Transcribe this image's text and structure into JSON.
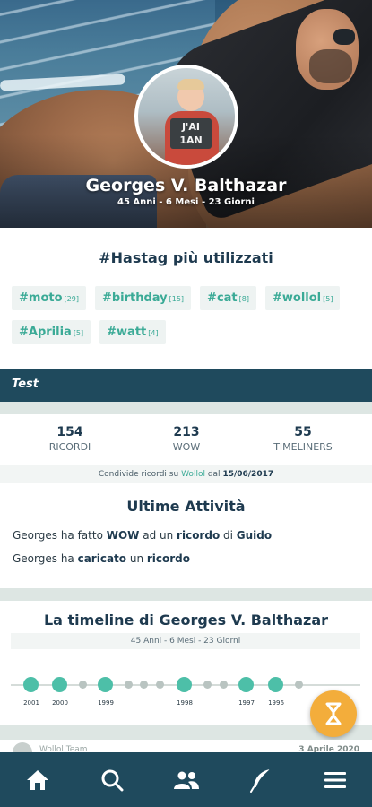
{
  "profile": {
    "name": "Georges V. Balthazar",
    "age": "45 Anni - 6 Mesi - 23 Giorni",
    "avatar_sign": "J'AI 1AN"
  },
  "hashtags": {
    "title": "#Hastag più utilizzati",
    "items": [
      {
        "tag": "#moto",
        "count": "[29]"
      },
      {
        "tag": "#birthday",
        "count": "[15]"
      },
      {
        "tag": "#cat",
        "count": "[8]"
      },
      {
        "tag": "#wollol",
        "count": "[5]"
      },
      {
        "tag": "#Aprilia",
        "count": "[5]"
      },
      {
        "tag": "#watt",
        "count": "[4]"
      }
    ]
  },
  "section_label": "Test",
  "stats": {
    "ricordi": {
      "value": "154",
      "label": "RICORDI"
    },
    "wow": {
      "value": "213",
      "label": "WOW"
    },
    "timeliners": {
      "value": "55",
      "label": "TIMELINERS"
    }
  },
  "since": {
    "prefix": "Condivide ricordi su",
    "brand": "Wollol",
    "middle": "dal",
    "date": "15/06/2017"
  },
  "activities": {
    "title": "Ultime Attività",
    "a1": {
      "p1": "Georges ha fatto ",
      "b1": "WOW",
      "p2": " ad un ",
      "b2": "ricordo",
      "p3": " di ",
      "b3": "Guido"
    },
    "a2": {
      "p1": "Georges ha ",
      "b1": "caricato",
      "p2": " un ",
      "b2": "ricordo"
    }
  },
  "timeline": {
    "title": "La timeline di Georges V. Balthazar",
    "subtitle": "45 Anni - 6 Mesi - 23 Giorni",
    "years": [
      "2001",
      "2000",
      "1999",
      "1998",
      "1997",
      "1996"
    ]
  },
  "peek": {
    "name": "Wollol Team",
    "date": "3 Aprile 2020"
  },
  "nav": [
    "home-icon",
    "search-icon",
    "people-icon",
    "feather-icon",
    "menu-icon"
  ],
  "colors": {
    "primary": "#1f4a5d",
    "accent": "#3aaa96",
    "fab": "#f3ad3b"
  }
}
